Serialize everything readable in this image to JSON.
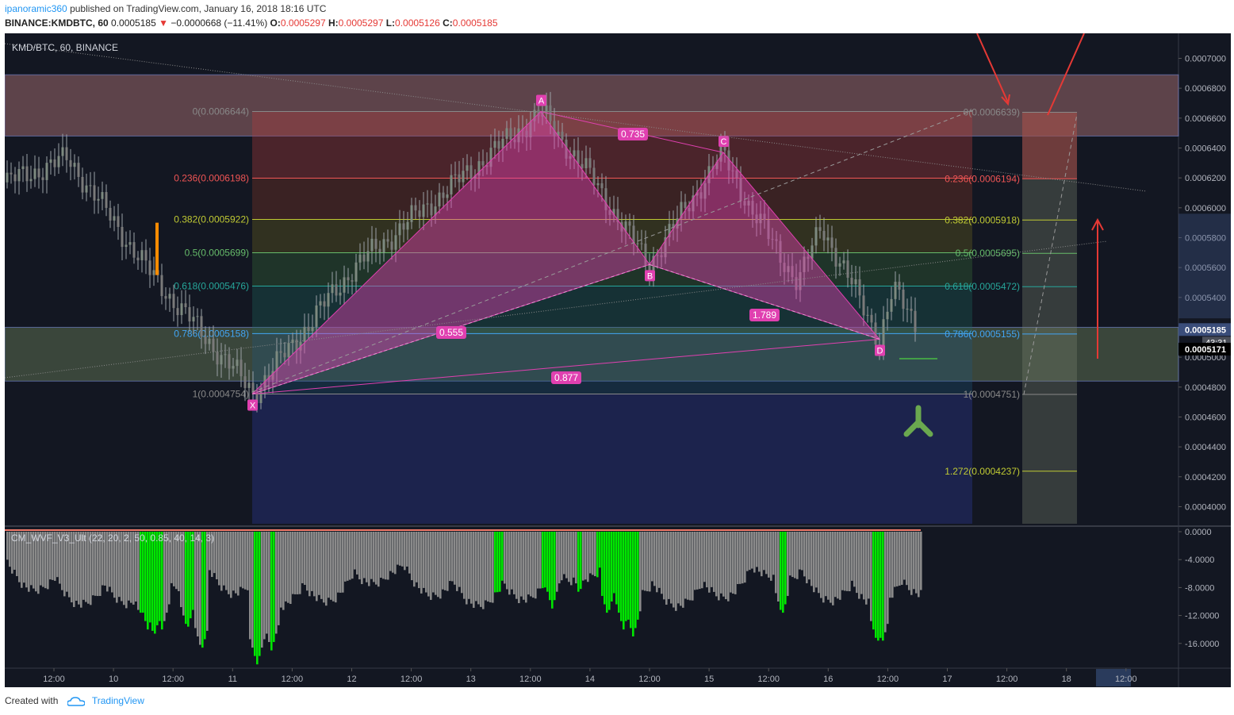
{
  "header": {
    "author": "ipanoramic360",
    "published": "published on TradingView.com, January 16, 2018 18:16 UTC",
    "symbol_line": "BINANCE:KMDBTC, 60",
    "last": "0.0005185",
    "change": "−0.0000668 (−11.41%)",
    "o_label": "O:",
    "o": "0.0005297",
    "h_label": "H:",
    "h": "0.0005297",
    "l_label": "L:",
    "l": "0.0005126",
    "c_label": "C:",
    "c": "0.0005185"
  },
  "chart_title": "KMD/BTC, 60, BINANCE",
  "indicator_label": "CM_WVF_V3_Ult (22, 20, 2, 50, 0.85, 40, 14, 3)",
  "footer": {
    "created_with": "Created with",
    "brand": "TradingView"
  },
  "colors": {
    "background": "#131722",
    "up": "#22ab94",
    "down": "#f7525f",
    "harmonic": "#e040b0",
    "arrow_red": "#e53935",
    "arrow_green": "#6aa84f",
    "wvf_gray": "#8a8a8a",
    "wvf_green": "#00e600"
  },
  "price_axis": {
    "ticks": [
      "0.0007000",
      "0.0006800",
      "0.0006600",
      "0.0006400",
      "0.0006200",
      "0.0006000",
      "0.0005800",
      "0.0005600",
      "0.0005400",
      "0.0005200",
      "0.0005000",
      "0.0004800",
      "0.0004600",
      "0.0004400",
      "0.0004200",
      "0.0004000"
    ],
    "last_price": "0.0005185",
    "countdown": "43:31",
    "marker_price": "0.0005171"
  },
  "indicator_axis": {
    "ticks": [
      "0.0000",
      "-4.0000",
      "-8.0000",
      "-12.0000",
      "-16.0000"
    ]
  },
  "time_axis": {
    "labels": [
      "12:00",
      "10",
      "12:00",
      "11",
      "12:00",
      "12",
      "12:00",
      "13",
      "12:00",
      "14",
      "12:00",
      "15",
      "12:00",
      "16",
      "12:00",
      "17",
      "12:00",
      "18",
      "12:00"
    ]
  },
  "chart_data": {
    "type": "candlestick_with_harmonic_pattern",
    "symbol": "KMD/BTC",
    "exchange": "BINANCE",
    "interval": "60",
    "ylim": [
      0.00039,
      0.00071
    ],
    "harmonic_points": [
      {
        "label": "X",
        "price": 0.0004754
      },
      {
        "label": "A",
        "price": 0.0006644
      },
      {
        "label": "B",
        "price": 0.000562
      },
      {
        "label": "C",
        "price": 0.000637
      },
      {
        "label": "D",
        "price": 0.000512
      }
    ],
    "harmonic_ratios": [
      "0.735",
      "0.555",
      "1.789",
      "0.877"
    ],
    "fib_left": [
      {
        "ratio": "0",
        "label": "0(0.0006644)",
        "price": 0.0006644
      },
      {
        "ratio": "0.236",
        "label": "0.236(0.0006198)",
        "price": 0.0006198
      },
      {
        "ratio": "0.382",
        "label": "0.382(0.0005922)",
        "price": 0.0005922
      },
      {
        "ratio": "0.5",
        "label": "0.5(0.0005699)",
        "price": 0.0005699
      },
      {
        "ratio": "0.618",
        "label": "0.618(0.0005476)",
        "price": 0.0005476
      },
      {
        "ratio": "0.786",
        "label": "0.786(0.0005158)",
        "price": 0.0005158
      },
      {
        "ratio": "1",
        "label": "1(0.0004754)",
        "price": 0.0004754
      }
    ],
    "fib_right": [
      {
        "ratio": "0",
        "label": "0(0.0006639)",
        "price": 0.0006639
      },
      {
        "ratio": "0.236",
        "label": "0.236(0.0006194)",
        "price": 0.0006194
      },
      {
        "ratio": "0.382",
        "label": "0.382(0.0005918)",
        "price": 0.0005918
      },
      {
        "ratio": "0.5",
        "label": "0.5(0.0005695)",
        "price": 0.0005695
      },
      {
        "ratio": "0.618",
        "label": "0.618(0.0005472)",
        "price": 0.0005472
      },
      {
        "ratio": "0.786",
        "label": "0.786(0.0005155)",
        "price": 0.0005155
      },
      {
        "ratio": "1",
        "label": "1(0.0004751)",
        "price": 0.0004751
      },
      {
        "ratio": "1.272",
        "label": "1.272(0.0004237)",
        "price": 0.0004237
      }
    ],
    "zones": [
      {
        "name": "resistance",
        "from": 0.000648,
        "to": 0.000689
      },
      {
        "name": "support",
        "from": 0.000484,
        "to": 0.00052
      }
    ],
    "indicator": {
      "name": "CM_WVF_V3_Ult",
      "ylim": [
        -18,
        0
      ],
      "ticks": [
        0,
        -4,
        -8,
        -12,
        -16
      ]
    }
  }
}
